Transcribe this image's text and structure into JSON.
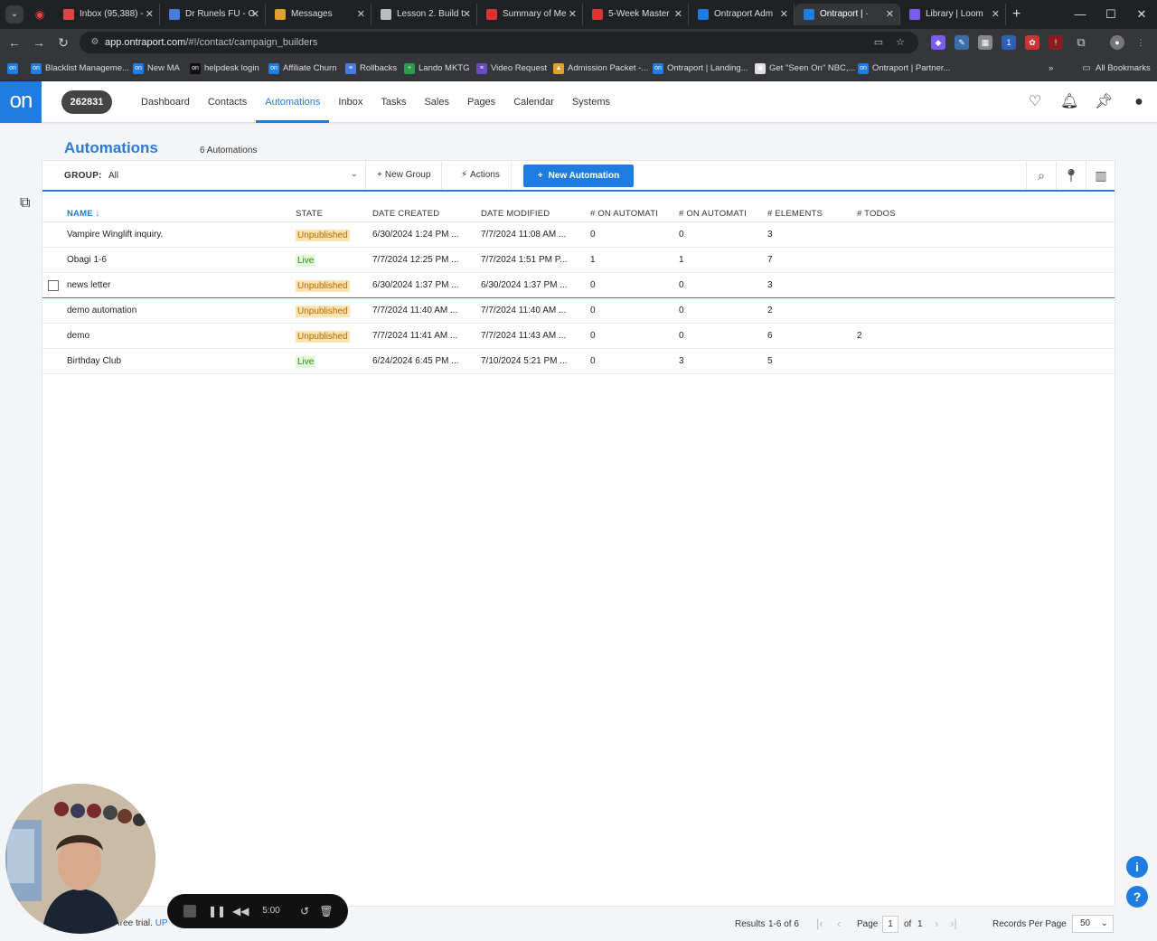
{
  "browser": {
    "tabs": [
      {
        "title": "Inbox (95,388) -",
        "icon_color": "#d44"
      },
      {
        "title": "Dr Runels FU - G",
        "icon_color": "#4a7ce0"
      },
      {
        "title": "Messages",
        "icon_color": "#e0a030"
      },
      {
        "title": "Lesson 2. Build t",
        "icon_color": "#bbbbbb"
      },
      {
        "title": "Summary of Me",
        "icon_color": "#d33"
      },
      {
        "title": "5-Week Master",
        "icon_color": "#d33"
      },
      {
        "title": "Ontraport Adm",
        "icon_color": "#1f7ce0"
      },
      {
        "title": "Ontraport | ·",
        "icon_color": "#1f7ce0",
        "active": true
      },
      {
        "title": "Library | Loom",
        "icon_color": "#7b5cf0"
      }
    ],
    "url_domain": "app.ontraport.com",
    "url_path": "/#!/contact/campaign_builders",
    "bookmarks": [
      {
        "label": "Blacklist Manageme...",
        "icon": "on",
        "color": "#1f7ce0"
      },
      {
        "label": "New MA",
        "icon": "on",
        "color": "#1f7ce0"
      },
      {
        "label": "helpdesk login",
        "icon": "on",
        "color": "#111111"
      },
      {
        "label": "Affiliate Churn",
        "icon": "on",
        "color": "#1f7ce0"
      },
      {
        "label": "Rollbacks",
        "icon": "≡",
        "color": "#4a7ce0"
      },
      {
        "label": "Lando MKTG",
        "icon": "+",
        "color": "#2a9d4a"
      },
      {
        "label": "Video Request",
        "icon": "≡",
        "color": "#6a4cc0"
      },
      {
        "label": "Admission Packet -...",
        "icon": "▲",
        "color": "#e0a030"
      },
      {
        "label": "Ontraport | Landing...",
        "icon": "on",
        "color": "#1f7ce0"
      },
      {
        "label": "Get \"Seen On\" NBC,...",
        "icon": "▣",
        "color": "#dddddd"
      },
      {
        "label": "Ontraport | Partner...",
        "icon": "on",
        "color": "#1f7ce0"
      }
    ],
    "all_bookmarks": "All Bookmarks"
  },
  "header": {
    "logo": "on",
    "account_id": "262831",
    "nav": [
      "Dashboard",
      "Contacts",
      "Automations",
      "Inbox",
      "Tasks",
      "Sales",
      "Pages",
      "Calendar",
      "Systems"
    ],
    "active_nav": "Automations",
    "icons": [
      "heart-icon",
      "bell-icon",
      "pin-icon",
      "user-icon"
    ]
  },
  "page": {
    "title": "Automations",
    "count_label": "6 Automations"
  },
  "toolbar": {
    "group_label": "GROUP:",
    "group_value": "All",
    "new_group": "New Group",
    "actions": "Actions",
    "new_automation": "New Automation"
  },
  "table": {
    "columns": [
      "NAME",
      "STATE",
      "DATE CREATED",
      "DATE MODIFIED",
      "# ON AUTOMATI",
      "# ON AUTOMATI",
      "# ELEMENTS",
      "# TODOS"
    ],
    "sorted_column": "NAME",
    "rows": [
      {
        "name": "Vampire Winglift inquiry.",
        "state": "Unpublished",
        "created": "6/30/2024 1:24 PM ...",
        "modified": "7/7/2024 11:08 AM ...",
        "on1": "0",
        "on2": "0",
        "elements": "3",
        "todos": ""
      },
      {
        "name": "Obagi 1-6",
        "state": "Live",
        "created": "7/7/2024 12:25 PM ...",
        "modified": "7/7/2024 1:51 PM P...",
        "on1": "1",
        "on2": "1",
        "elements": "7",
        "todos": ""
      },
      {
        "name": "news letter",
        "state": "Unpublished",
        "created": "6/30/2024 1:37 PM ...",
        "modified": "6/30/2024 1:37 PM ...",
        "on1": "0",
        "on2": "0",
        "elements": "3",
        "todos": ""
      },
      {
        "name": "demo automation",
        "state": "Unpublished",
        "created": "7/7/2024 11:40 AM ...",
        "modified": "7/7/2024 11:40 AM ...",
        "on1": "0",
        "on2": "0",
        "elements": "2",
        "todos": ""
      },
      {
        "name": "demo",
        "state": "Unpublished",
        "created": "7/7/2024 11:41 AM ...",
        "modified": "7/7/2024 11:43 AM ...",
        "on1": "0",
        "on2": "0",
        "elements": "6",
        "todos": "2"
      },
      {
        "name": "Birthday Club",
        "state": "Live",
        "created": "6/24/2024 6:45 PM ...",
        "modified": "7/10/2024 5:21 PM ...",
        "on1": "0",
        "on2": "3",
        "elements": "5",
        "todos": ""
      }
    ],
    "state_colors": {
      "Unpublished": {
        "bg": "#fde3b0",
        "fg": "#b86a00"
      },
      "Live": {
        "bg": "#e2f6d8",
        "fg": "#2e8a1e"
      }
    }
  },
  "footer": {
    "results": "Results",
    "range": "1-6 of 6",
    "page_label": "Page",
    "page_value": "1",
    "of_label": "of",
    "page_total": "1",
    "records_label": "Records Per Page",
    "records_value": "50"
  },
  "loom": {
    "timer": "5:00",
    "trial_text": "free trial.",
    "trial_link": "UP"
  }
}
